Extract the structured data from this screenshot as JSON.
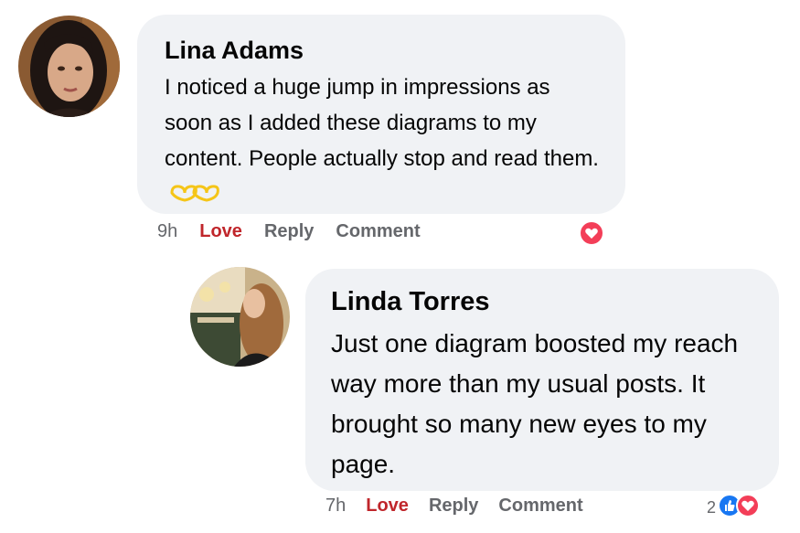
{
  "comments": [
    {
      "author": "Lina Adams",
      "text": "I noticed a huge jump in impressions as soon as I added these diagrams to my content. People actually stop and read them.",
      "time": "9h",
      "love_label": "Love",
      "reply_label": "Reply",
      "comment_label": "Comment",
      "reaction_icon": "love-reaction-icon",
      "text_emoji": "yellow-heart-hands-emoji"
    },
    {
      "author": "Linda Torres",
      "text": "Just one diagram boosted my reach way more than my usual posts. It brought so many new eyes to my page.",
      "time": "7h",
      "love_label": "Love",
      "reply_label": "Reply",
      "comment_label": "Comment",
      "reaction_count": "2",
      "reaction_icons": [
        "like-reaction-icon",
        "love-reaction-icon"
      ]
    }
  ],
  "colors": {
    "bubble": "#f0f2f5",
    "love": "#c0262b",
    "like": "#1877f2",
    "meta": "#65676b"
  }
}
